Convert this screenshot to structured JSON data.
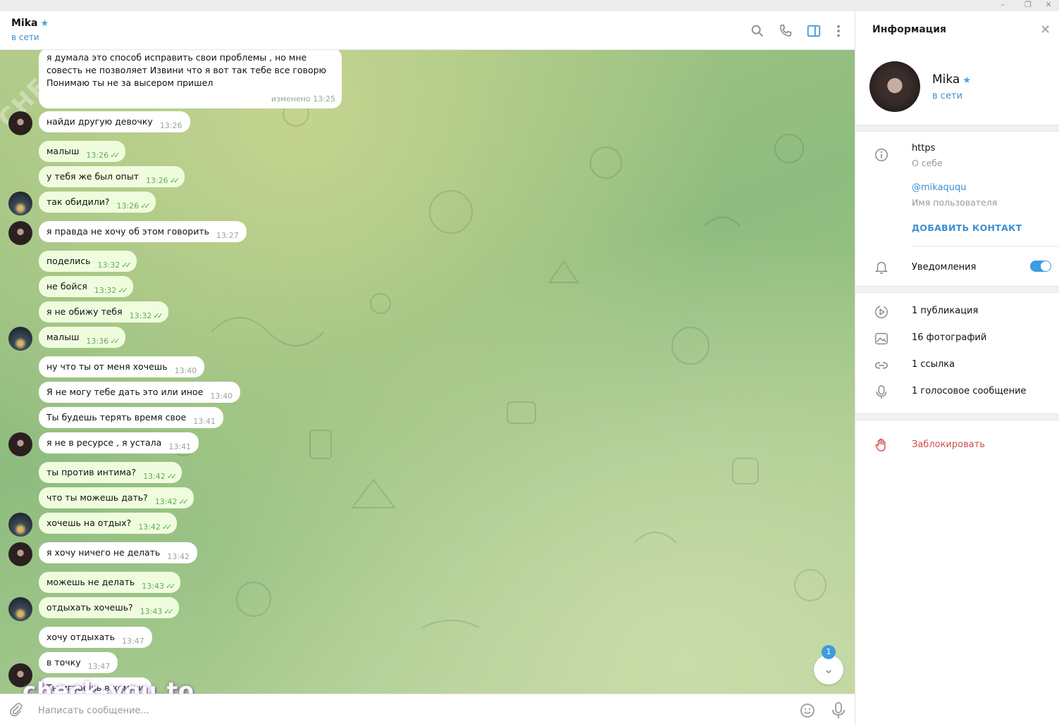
{
  "window": {
    "minimize": "–",
    "maximize": "❐",
    "close": "✕"
  },
  "chat": {
    "peer_name": "Mika",
    "peer_status": "в сети",
    "messages": [
      {
        "text": "я думала это способ исправить свои проблемы , но мне совесть не позволяет Извини что я вот так тебе все говорю Понимаю ты не за высером пришел",
        "lines": [
          "я думала это способ исправить свои проблемы , но мне совесть",
          "не позволяет",
          "Извини что я вот так тебе все говорю",
          "Понимаю ты не за высером пришел"
        ],
        "time": "изменено 13:25",
        "dir": "in"
      },
      {
        "text": "найди другую девочку",
        "time": "13:26",
        "dir": "in"
      },
      {
        "text": "малыш",
        "time": "13:26",
        "dir": "out"
      },
      {
        "text": "у тебя же был опыт",
        "time": "13:26",
        "dir": "out"
      },
      {
        "text": "так обидили?",
        "time": "13:26",
        "dir": "out"
      },
      {
        "text": "я правда не хочу об этом говорить",
        "time": "13:27",
        "dir": "in"
      },
      {
        "text": "поделись",
        "time": "13:32",
        "dir": "out"
      },
      {
        "text": "не бойся",
        "time": "13:32",
        "dir": "out"
      },
      {
        "text": "я не обижу тебя",
        "time": "13:32",
        "dir": "out"
      },
      {
        "text": "малыш",
        "time": "13:36",
        "dir": "out"
      },
      {
        "text": "ну что ты от меня хочешь",
        "time": "13:40",
        "dir": "in"
      },
      {
        "text": "Я не могу тебе дать это или иное",
        "time": "13:40",
        "dir": "in"
      },
      {
        "text": "Ты будешь терять время свое",
        "time": "13:41",
        "dir": "in"
      },
      {
        "text": "я не в ресурсе , я устала",
        "time": "13:41",
        "dir": "in"
      },
      {
        "text": "ты против интима?",
        "time": "13:42",
        "dir": "out"
      },
      {
        "text": "что ты можешь дать?",
        "time": "13:42",
        "dir": "out"
      },
      {
        "text": "хочешь на отдых?",
        "time": "13:42",
        "dir": "out"
      },
      {
        "text": "я хочу ничего не делать",
        "time": "13:42",
        "dir": "in"
      },
      {
        "text": "можешь не делать",
        "time": "13:43",
        "dir": "out"
      },
      {
        "text": "отдыхать хочешь?",
        "time": "13:43",
        "dir": "out"
      },
      {
        "text": "хочу отдыхать",
        "time": "13:47",
        "dir": "in"
      },
      {
        "text": "в точку",
        "time": "13:47",
        "dir": "in"
      },
      {
        "text": "Ты играешь в комп и",
        "time": "",
        "dir": "in"
      }
    ],
    "unread_count": "1",
    "composer_placeholder": "Написать сообщение...",
    "watermark": "check-you.to",
    "watermark_diag": "CHECK-YOU.ME"
  },
  "sidebar": {
    "title": "Информация",
    "name": "Mika",
    "status": "в сети",
    "bio_value": "https",
    "bio_label": "О себе",
    "username_value": "@mikaququ",
    "username_label": "Имя пользователя",
    "add_contact": "ДОБАВИТЬ КОНТАКТ",
    "notifications_label": "Уведомления",
    "notifications_on": true,
    "media": [
      {
        "icon": "play-circle-icon",
        "label": "1 публикация"
      },
      {
        "icon": "photo-icon",
        "label": "16 фотографий"
      },
      {
        "icon": "link-icon",
        "label": "1 ссылка"
      },
      {
        "icon": "microphone-icon",
        "label": "1 голосовое сообщение"
      }
    ],
    "block": "Заблокировать"
  },
  "colors": {
    "accent": "#3d8fd1",
    "outgoing_bubble": "#effdde",
    "danger": "#d24b4b"
  }
}
